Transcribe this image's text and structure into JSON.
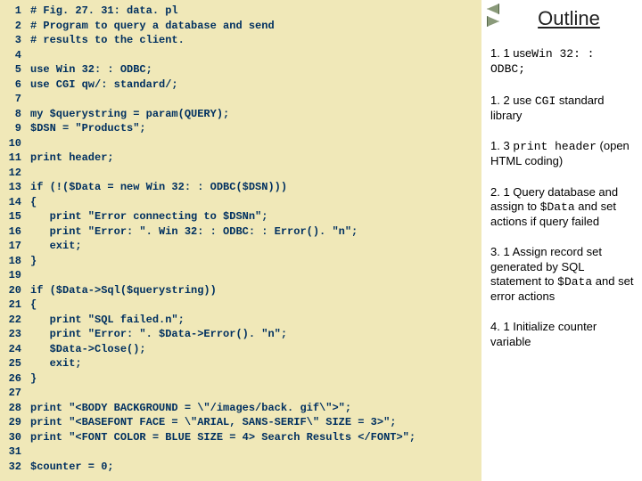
{
  "code": {
    "lines": [
      "# Fig. 27. 31: data. pl",
      "# Program to query a database and send",
      "# results to the client.",
      "",
      "use Win 32: : ODBC;",
      "use CGI qw/: standard/;",
      "",
      "my $querystring = param(QUERY);",
      "$DSN = \"Products\";",
      "",
      "print header;",
      "",
      "if (!($Data = new Win 32: : ODBC($DSN)))",
      "{",
      "   print \"Error connecting to $DSNn\";",
      "   print \"Error: \". Win 32: : ODBC: : Error(). \"n\";",
      "   exit;",
      "}",
      "",
      "if ($Data->Sql($querystring))",
      "{",
      "   print \"SQL failed.n\";",
      "   print \"Error: \". $Data->Error(). \"n\";",
      "   $Data->Close();",
      "   exit;",
      "}",
      "",
      "print \"<BODY BACKGROUND = \\\"/images/back. gif\\\">\";",
      "print \"<BASEFONT FACE = \\\"ARIAL, SANS-SERIF\\\" SIZE = 3>\";",
      "print \"<FONT COLOR = BLUE SIZE = 4> Search Results </FONT>\";",
      "",
      "$counter = 0;"
    ]
  },
  "outline": {
    "title": "Outline",
    "items": [
      {
        "num": "1. 1 use",
        "mono": "Win 32: : ODBC;",
        "tail": ""
      },
      {
        "num": "1. 2 use ",
        "mono": "CGI",
        "tail": " standard library"
      },
      {
        "num": "1. 3 ",
        "mono": "print header",
        "tail": " (open HTML coding)"
      },
      {
        "num": "2. 1 Query database and assign to ",
        "mono": "$Data",
        "tail": " and set actions if query failed"
      },
      {
        "num": "3. 1 Assign record set generated by SQL statement to ",
        "mono": "$Data",
        "tail": " and set error actions"
      },
      {
        "num": "4. 1 Initialize counter variable",
        "mono": "",
        "tail": ""
      }
    ]
  }
}
